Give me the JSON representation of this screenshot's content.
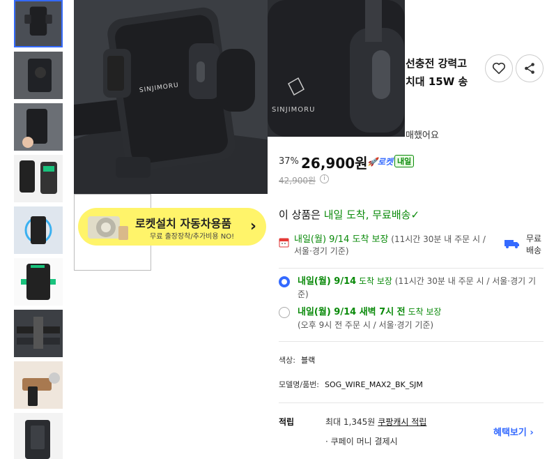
{
  "gallery": {
    "thumbnails": [
      {
        "name": "thumb-1",
        "active": true
      },
      {
        "name": "thumb-2",
        "active": false
      },
      {
        "name": "thumb-3",
        "active": false
      },
      {
        "name": "thumb-4",
        "active": false
      },
      {
        "name": "thumb-5",
        "active": false
      },
      {
        "name": "thumb-6",
        "active": false
      },
      {
        "name": "thumb-7",
        "active": false
      },
      {
        "name": "thumb-8",
        "active": false
      },
      {
        "name": "thumb-9",
        "active": false
      }
    ],
    "brand_text": "SINJIMORU"
  },
  "rocket_banner": {
    "title": "로켓설치 자동차용품",
    "subtitle": "무료 출장장착/추가비용 NO!"
  },
  "product": {
    "title_line1": "선충전 강력고",
    "title_line2": "치대 15W 송",
    "purchase_text": "매했어요"
  },
  "price": {
    "discount": "37%",
    "sale": "26,900원",
    "original": "42,900원",
    "rocket_label": "로켓",
    "rocket_day": "내일",
    "info": "i"
  },
  "delivery": {
    "headline_prefix": "이 상품은 ",
    "headline_green": "내일 도착, 무료배송",
    "check": "✓",
    "row1_green": "내일(월) 9/14 도착 보장",
    "row1_rest": " (11시간 30분 내 주문 시 / 서울·경기 기준)",
    "free_label": "무료\n배송",
    "options": [
      {
        "green": "내일(월) 9/14",
        "green2": " 도착 보장",
        "rest": " (11시간 30분 내 주문 시 / 서울·경기 기준)",
        "selected": true
      },
      {
        "green": "내일(월) 9/14 새벽 7시 전",
        "green2": " 도착 보장",
        "rest": "(오후 9시 전 주문 시 / 서울·경기 기준)",
        "selected": false
      }
    ]
  },
  "attributes": {
    "color_label": "색상:",
    "color_value": "블랙",
    "model_label": "모델명/품번:",
    "model_value": "SOG_WIRE_MAX2_BK_SJM"
  },
  "cash": {
    "label": "적립",
    "text": "최대 1,345원",
    "link": "쿠팡캐시 적립",
    "benefit_link": "혜택보기 ›",
    "coupay": "· 쿠페이 머니 결제시"
  },
  "colors": {
    "accent": "#346aff",
    "green": "#0a8a0a",
    "banner": "#fff46a"
  }
}
